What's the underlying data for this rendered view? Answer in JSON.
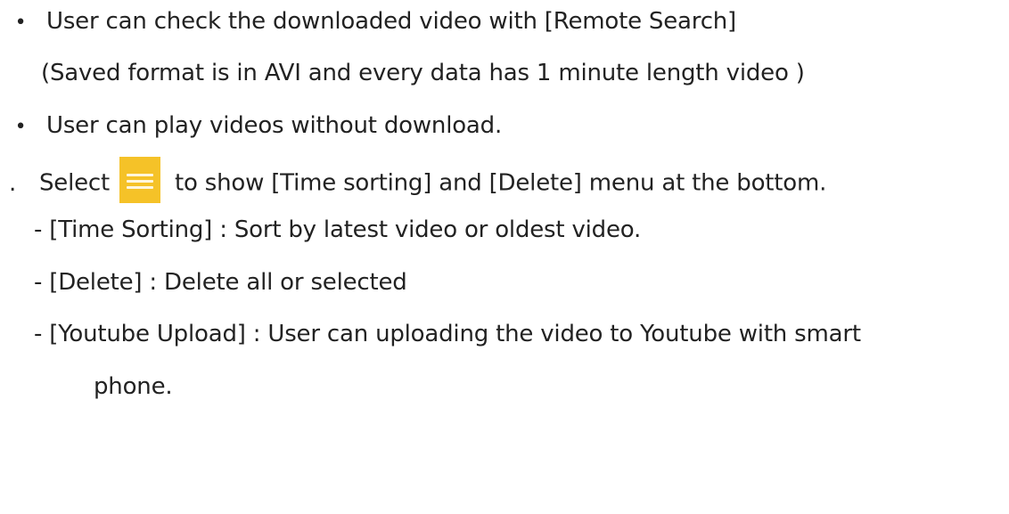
{
  "lines": {
    "remote_search": {
      "bullet": "•",
      "text": "User can check the downloaded video with [Remote Search]"
    },
    "saved_format": {
      "text": "(Saved format is in AVI and every data has 1 minute length video )"
    },
    "play_without_download": {
      "bullet": "•",
      "text": "User can play videos without download."
    },
    "select_menu": {
      "prefix": ".",
      "before": "Select",
      "icon": "hamburger-menu-icon",
      "after": "to show [Time sorting] and [Delete] menu at the bottom."
    },
    "time_sorting": {
      "text": "- [Time Sorting] : Sort by latest video or oldest video."
    },
    "delete": {
      "text": "- [Delete] : Delete all or selected"
    },
    "youtube_upload": {
      "text": "- [Youtube Upload] : User can uploading the video to Youtube with smart"
    },
    "youtube_upload_cont": {
      "text": "phone."
    }
  },
  "colors": {
    "icon_background": "#f5c228",
    "text": "#222222"
  }
}
